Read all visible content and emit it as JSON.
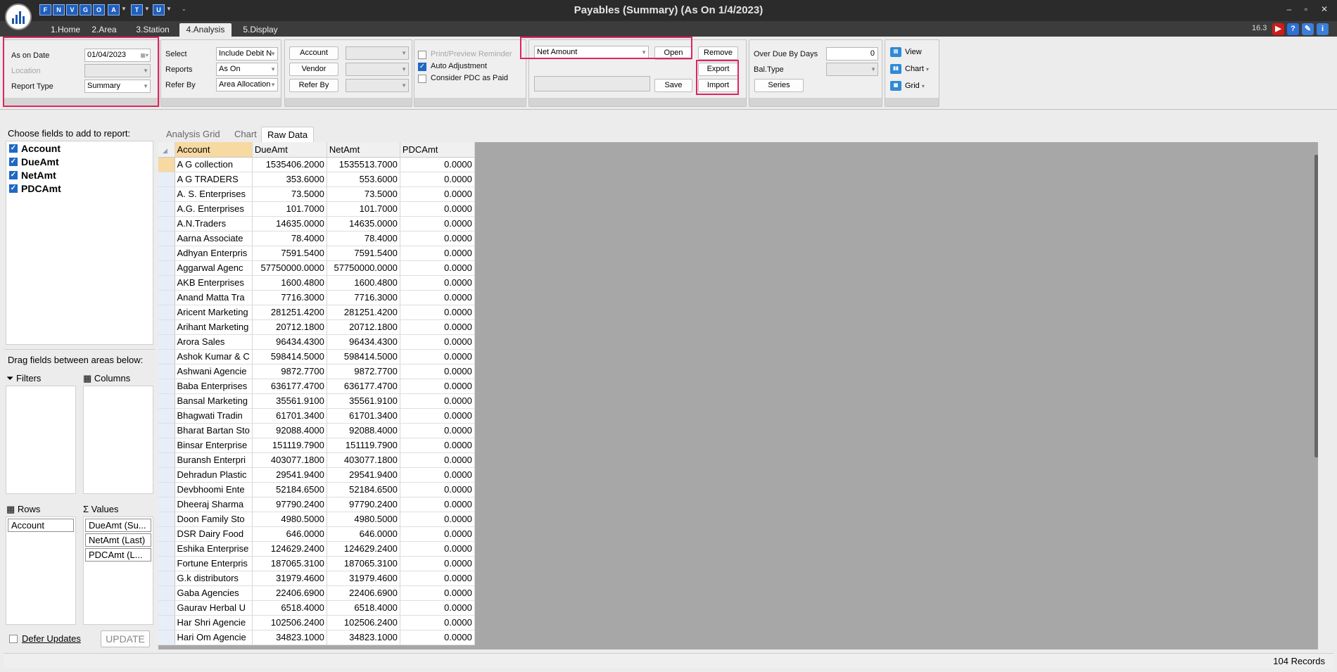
{
  "window": {
    "title": "Payables (Summary) (As On 1/4/2023)",
    "version": "16.3",
    "quick_access": [
      "F",
      "N",
      "V",
      "G",
      "O",
      "A",
      "T",
      "U"
    ]
  },
  "ribbon_tabs": [
    "1.Home",
    "2.Area",
    "3.Station",
    "4.Analysis",
    "5.Display"
  ],
  "ribbon": {
    "as_on_date_label": "As on Date",
    "as_on_date_value": "01/04/2023",
    "location_label": "Location",
    "location_value": "",
    "report_type_label": "Report Type",
    "report_type_value": "Summary",
    "select_label": "Select",
    "select_value": "Include Debit N",
    "reports_label": "Reports",
    "reports_value": "As On",
    "refer_by_label": "Refer By",
    "refer_by_value": "Area Allocation",
    "account_button": "Account",
    "vendor_button": "Vendor",
    "refer_by_button": "Refer By",
    "print_preview_reminder": "Print/Preview Reminder",
    "auto_adjustment": "Auto Adjustment",
    "consider_pdc": "Consider PDC as Paid",
    "layout_value": "Net Amount",
    "open_button": "Open",
    "remove_button": "Remove",
    "export_button": "Export",
    "import_button": "Import",
    "save_button": "Save",
    "over_due_label": "Over Due By Days",
    "over_due_value": "0",
    "bal_type_label": "Bal.Type",
    "series_button": "Series",
    "view_button": "View",
    "chart_button": "Chart",
    "grid_button": "Grid"
  },
  "field_chooser": {
    "title": "Choose fields to add to report:",
    "fields": [
      {
        "name": "Account",
        "checked": true
      },
      {
        "name": "DueAmt",
        "checked": true
      },
      {
        "name": "NetAmt",
        "checked": true
      },
      {
        "name": "PDCAmt",
        "checked": true
      }
    ],
    "drag_title": "Drag fields between areas below:",
    "filters_label": "Filters",
    "columns_label": "Columns",
    "rows_label": "Rows",
    "values_label": "Values",
    "rows_items": [
      "Account"
    ],
    "values_items": [
      "DueAmt (Su...",
      "NetAmt (Last)",
      "PDCAmt (L..."
    ],
    "defer_updates": "Defer Updates",
    "update_button": "UPDATE"
  },
  "grid_tabs": [
    "Analysis Grid",
    "Chart",
    "Raw Data"
  ],
  "grid": {
    "columns": [
      "Account",
      "DueAmt",
      "NetAmt",
      "PDCAmt"
    ],
    "rows": [
      [
        "A G collection",
        "1535406.2000",
        "1535513.7000",
        "0.0000"
      ],
      [
        "A G TRADERS",
        "353.6000",
        "553.6000",
        "0.0000"
      ],
      [
        "A. S. Enterprises",
        "73.5000",
        "73.5000",
        "0.0000"
      ],
      [
        "A.G. Enterprises",
        "101.7000",
        "101.7000",
        "0.0000"
      ],
      [
        "A.N.Traders",
        "14635.0000",
        "14635.0000",
        "0.0000"
      ],
      [
        "Aarna Associate",
        "78.4000",
        "78.4000",
        "0.0000"
      ],
      [
        "Adhyan Enterpris",
        "7591.5400",
        "7591.5400",
        "0.0000"
      ],
      [
        "Aggarwal Agenc",
        "57750000.0000",
        "57750000.0000",
        "0.0000"
      ],
      [
        "AKB Enterprises",
        "1600.4800",
        "1600.4800",
        "0.0000"
      ],
      [
        "Anand Matta Tra",
        "7716.3000",
        "7716.3000",
        "0.0000"
      ],
      [
        "Aricent Marketing",
        "281251.4200",
        "281251.4200",
        "0.0000"
      ],
      [
        "Arihant Marketing",
        "20712.1800",
        "20712.1800",
        "0.0000"
      ],
      [
        "Arora Sales",
        "96434.4300",
        "96434.4300",
        "0.0000"
      ],
      [
        "Ashok Kumar & C",
        "598414.5000",
        "598414.5000",
        "0.0000"
      ],
      [
        "Ashwani Agencie",
        "9872.7700",
        "9872.7700",
        "0.0000"
      ],
      [
        "Baba Enterprises",
        "636177.4700",
        "636177.4700",
        "0.0000"
      ],
      [
        "Bansal Marketing",
        "35561.9100",
        "35561.9100",
        "0.0000"
      ],
      [
        "Bhagwati Tradin",
        "61701.3400",
        "61701.3400",
        "0.0000"
      ],
      [
        "Bharat Bartan Sto",
        "92088.4000",
        "92088.4000",
        "0.0000"
      ],
      [
        "Binsar Enterprise",
        "151119.7900",
        "151119.7900",
        "0.0000"
      ],
      [
        "Buransh Enterpri",
        "403077.1800",
        "403077.1800",
        "0.0000"
      ],
      [
        "Dehradun Plastic",
        "29541.9400",
        "29541.9400",
        "0.0000"
      ],
      [
        "Devbhoomi Ente",
        "52184.6500",
        "52184.6500",
        "0.0000"
      ],
      [
        "Dheeraj Sharma",
        "97790.2400",
        "97790.2400",
        "0.0000"
      ],
      [
        "Doon Family Sto",
        "4980.5000",
        "4980.5000",
        "0.0000"
      ],
      [
        "DSR Dairy Food",
        "646.0000",
        "646.0000",
        "0.0000"
      ],
      [
        "Eshika Enterprise",
        "124629.2400",
        "124629.2400",
        "0.0000"
      ],
      [
        "Fortune Enterpris",
        "187065.3100",
        "187065.3100",
        "0.0000"
      ],
      [
        "G.k distributors",
        "31979.4600",
        "31979.4600",
        "0.0000"
      ],
      [
        "Gaba Agencies",
        "22406.6900",
        "22406.6900",
        "0.0000"
      ],
      [
        "Gaurav Herbal U",
        "6518.4000",
        "6518.4000",
        "0.0000"
      ],
      [
        "Har Shri Agencie",
        "102506.2400",
        "102506.2400",
        "0.0000"
      ],
      [
        "Hari Om Agencie",
        "34823.1000",
        "34823.1000",
        "0.0000"
      ]
    ]
  },
  "status": {
    "records": "104 Records"
  }
}
